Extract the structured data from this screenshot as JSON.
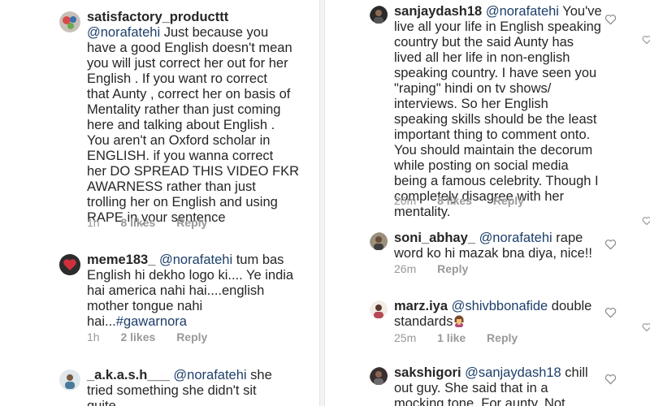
{
  "left_comments": [
    {
      "username": "satisfactory_producttt",
      "mention": "@norafatehi",
      "text_lines": [
        " Just because you",
        "have a good English doesn't mean",
        "you will just correct her out for her",
        "English . If you want ro correct",
        "that Aunty , correct her on basis of",
        "Mentality rather than just coming",
        "here and talking about English .",
        "You aren't an Oxford scholar in",
        "ENGLISH.  if you wanna correct",
        "her DO SPREAD THIS VIDEO FKR",
        "AWARNESS rather than just",
        "trolling her on English and using",
        "RAPE in your sentence"
      ],
      "time": "1h",
      "likes": "8 likes",
      "reply": "Reply"
    },
    {
      "username": "meme183_",
      "mention": "@norafatehi",
      "text_lines": [
        " tum bas",
        "English hi dekho logo ki.... Ye india",
        "hai america nahi hai....english",
        "mother tongue nahi",
        "hai..."
      ],
      "hashtag": "#gawarnora",
      "time": "1h",
      "likes": "2 likes",
      "reply": "Reply"
    },
    {
      "username": "_a.k.a.s.h___",
      "mention": "@norafatehi",
      "text_lines": [
        " she",
        "tried something she didn't sit",
        "quite"
      ]
    }
  ],
  "right_comments": [
    {
      "username": "sanjaydash18",
      "mention": "@norafatehi",
      "text_lines": [
        " You've",
        "live all your life in English speaking",
        "country but the said Aunty has",
        "lived all her life in non-english",
        "speaking country. I have seen you",
        "\"raping\" hindi on tv shows/",
        "interviews. So her English",
        "speaking skills should be the least",
        "important thing to comment onto.",
        "You should maintain the decorum",
        "while posting on social media",
        "being a famous celebrity. Though I",
        "completely disagree with her",
        "mentality."
      ],
      "time": "26m",
      "likes": "8 likes",
      "reply": "Reply"
    },
    {
      "username": "soni_abhay_",
      "mention": "@norafatehi",
      "text_lines": [
        " rape",
        "word ko hi mazak bna diya, nice!!"
      ],
      "time": "26m",
      "reply": "Reply"
    },
    {
      "username": "marz.iya",
      "mention": "@shivbbonafide",
      "text_lines": [
        " double",
        "standards"
      ],
      "time": "25m",
      "likes": "1 like",
      "reply": "Reply"
    },
    {
      "username": "sakshigori",
      "mention": "@sanjaydash18",
      "text_lines": [
        " chill",
        "out guy. She said that in a",
        "mocking tone. For aunty. Not"
      ]
    }
  ],
  "icons": {
    "heart": "heart-outline-icon",
    "emoji": "woman-facepalming-emoji"
  },
  "colors": {
    "text": "#262626",
    "mention": "#1d3f6b",
    "meta": "#999999"
  }
}
